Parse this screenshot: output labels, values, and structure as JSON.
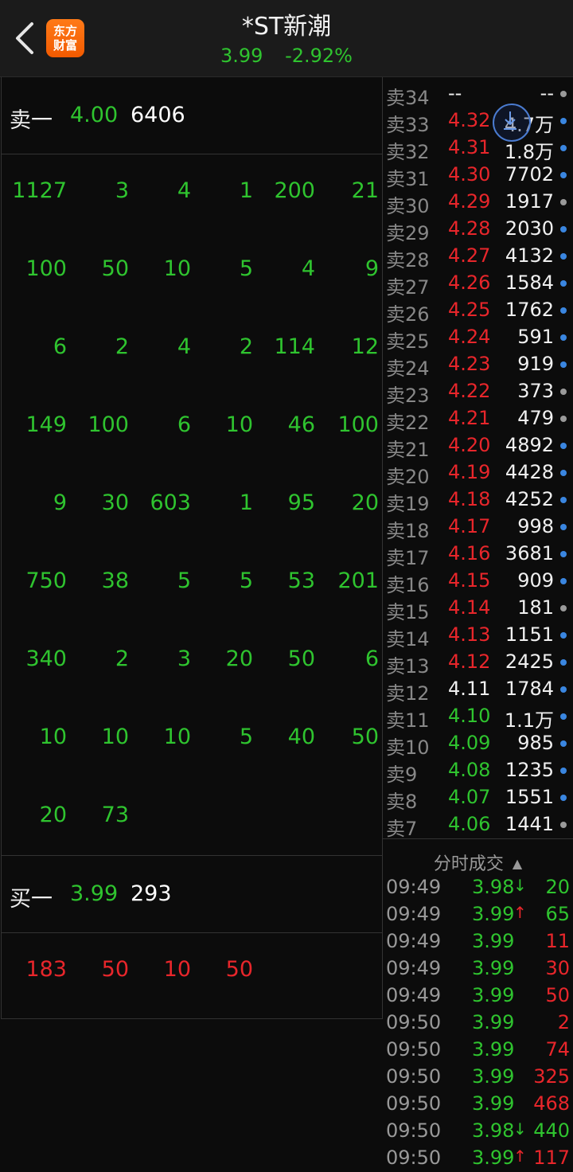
{
  "header": {
    "title": "*ST新潮",
    "price": "3.99",
    "change_pct": "-2.92%",
    "logo_line1": "东方",
    "logo_line2": "财富"
  },
  "sell_one": {
    "label": "卖一",
    "price": "4.00",
    "volume": "6406"
  },
  "buy_one": {
    "label": "买一",
    "price": "3.99",
    "volume": "293"
  },
  "sell_queue": [
    [
      "1127",
      "3",
      "4",
      "1",
      "200",
      "21"
    ],
    [
      "100",
      "50",
      "10",
      "5",
      "4",
      "9"
    ],
    [
      "6",
      "2",
      "4",
      "2",
      "114",
      "12"
    ],
    [
      "149",
      "100",
      "6",
      "10",
      "46",
      "100"
    ],
    [
      "9",
      "30",
      "603",
      "1",
      "95",
      "20"
    ],
    [
      "750",
      "38",
      "5",
      "5",
      "53",
      "201"
    ],
    [
      "340",
      "2",
      "3",
      "20",
      "50",
      "6"
    ],
    [
      "10",
      "10",
      "10",
      "5",
      "40",
      "50"
    ],
    [
      "20",
      "73"
    ]
  ],
  "buy_queue": [
    [
      "183",
      "50",
      "10",
      "50"
    ]
  ],
  "asks": [
    {
      "label": "卖34",
      "price": "--",
      "vol": "--",
      "pc": "white",
      "dot": "gray"
    },
    {
      "label": "卖33",
      "price": "4.32",
      "vol": "4.7万",
      "pc": "red",
      "dot": "blue"
    },
    {
      "label": "卖32",
      "price": "4.31",
      "vol": "1.8万",
      "pc": "red",
      "dot": "blue"
    },
    {
      "label": "卖31",
      "price": "4.30",
      "vol": "7702",
      "pc": "red",
      "dot": "blue"
    },
    {
      "label": "卖30",
      "price": "4.29",
      "vol": "1917",
      "pc": "red",
      "dot": "gray"
    },
    {
      "label": "卖29",
      "price": "4.28",
      "vol": "2030",
      "pc": "red",
      "dot": "blue"
    },
    {
      "label": "卖28",
      "price": "4.27",
      "vol": "4132",
      "pc": "red",
      "dot": "blue"
    },
    {
      "label": "卖27",
      "price": "4.26",
      "vol": "1584",
      "pc": "red",
      "dot": "blue"
    },
    {
      "label": "卖26",
      "price": "4.25",
      "vol": "1762",
      "pc": "red",
      "dot": "blue"
    },
    {
      "label": "卖25",
      "price": "4.24",
      "vol": "591",
      "pc": "red",
      "dot": "blue"
    },
    {
      "label": "卖24",
      "price": "4.23",
      "vol": "919",
      "pc": "red",
      "dot": "blue"
    },
    {
      "label": "卖23",
      "price": "4.22",
      "vol": "373",
      "pc": "red",
      "dot": "gray"
    },
    {
      "label": "卖22",
      "price": "4.21",
      "vol": "479",
      "pc": "red",
      "dot": "gray"
    },
    {
      "label": "卖21",
      "price": "4.20",
      "vol": "4892",
      "pc": "red",
      "dot": "blue"
    },
    {
      "label": "卖20",
      "price": "4.19",
      "vol": "4428",
      "pc": "red",
      "dot": "blue"
    },
    {
      "label": "卖19",
      "price": "4.18",
      "vol": "4252",
      "pc": "red",
      "dot": "blue"
    },
    {
      "label": "卖18",
      "price": "4.17",
      "vol": "998",
      "pc": "red",
      "dot": "blue"
    },
    {
      "label": "卖17",
      "price": "4.16",
      "vol": "3681",
      "pc": "red",
      "dot": "blue"
    },
    {
      "label": "卖16",
      "price": "4.15",
      "vol": "909",
      "pc": "red",
      "dot": "blue"
    },
    {
      "label": "卖15",
      "price": "4.14",
      "vol": "181",
      "pc": "red",
      "dot": "gray"
    },
    {
      "label": "卖14",
      "price": "4.13",
      "vol": "1151",
      "pc": "red",
      "dot": "blue"
    },
    {
      "label": "卖13",
      "price": "4.12",
      "vol": "2425",
      "pc": "red",
      "dot": "blue"
    },
    {
      "label": "卖12",
      "price": "4.11",
      "vol": "1784",
      "pc": "white",
      "dot": "blue"
    },
    {
      "label": "卖11",
      "price": "4.10",
      "vol": "1.1万",
      "pc": "green",
      "dot": "blue"
    },
    {
      "label": "卖10",
      "price": "4.09",
      "vol": "985",
      "pc": "green",
      "dot": "blue"
    },
    {
      "label": "卖9",
      "price": "4.08",
      "vol": "1235",
      "pc": "green",
      "dot": "blue"
    },
    {
      "label": "卖8",
      "price": "4.07",
      "vol": "1551",
      "pc": "green",
      "dot": "blue"
    },
    {
      "label": "卖7",
      "price": "4.06",
      "vol": "1441",
      "pc": "green",
      "dot": "gray"
    }
  ],
  "trades_header": "分时成交",
  "trades": [
    {
      "time": "09:49",
      "price": "3.98",
      "dir": "↓",
      "vol": "20",
      "vc": "green"
    },
    {
      "time": "09:49",
      "price": "3.99",
      "dir": "↑",
      "vol": "65",
      "vc": "green"
    },
    {
      "time": "09:49",
      "price": "3.99",
      "dir": "",
      "vol": "11",
      "vc": "red"
    },
    {
      "time": "09:49",
      "price": "3.99",
      "dir": "",
      "vol": "30",
      "vc": "red"
    },
    {
      "time": "09:49",
      "price": "3.99",
      "dir": "",
      "vol": "50",
      "vc": "red"
    },
    {
      "time": "09:50",
      "price": "3.99",
      "dir": "",
      "vol": "2",
      "vc": "red"
    },
    {
      "time": "09:50",
      "price": "3.99",
      "dir": "",
      "vol": "74",
      "vc": "red"
    },
    {
      "time": "09:50",
      "price": "3.99",
      "dir": "",
      "vol": "325",
      "vc": "red"
    },
    {
      "time": "09:50",
      "price": "3.99",
      "dir": "",
      "vol": "468",
      "vc": "red"
    },
    {
      "time": "09:50",
      "price": "3.98",
      "dir": "↓",
      "vol": "440",
      "vc": "green"
    },
    {
      "time": "09:50",
      "price": "3.99",
      "dir": "↑",
      "vol": "117",
      "vc": "red"
    }
  ],
  "colors": {
    "red": "#e8262b",
    "green": "#2fc42f",
    "blue_dot": "#3a86e0",
    "gray_dot": "#9a9a9a",
    "accent_orange": "#f26a00"
  },
  "icons": {
    "back": "chevron-left-icon",
    "overlay": "download-circle-icon"
  }
}
